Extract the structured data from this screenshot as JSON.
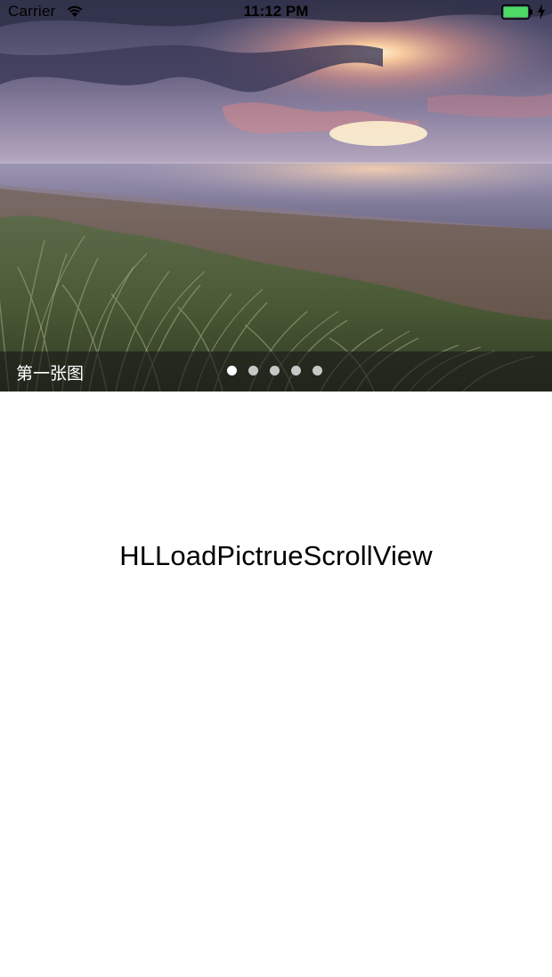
{
  "status_bar": {
    "carrier": "Carrier",
    "time": "11:12 PM",
    "battery_color": "#4cd964",
    "icons": [
      "wifi-icon",
      "battery-icon",
      "charging-bolt-icon"
    ]
  },
  "banner": {
    "caption": "第一张图",
    "page_count": 5,
    "current_page": 1,
    "active_dot_color": "#ffffff",
    "inactive_dot_color": "#c8c8c8"
  },
  "main": {
    "label": "HLLoadPictrueScrollView"
  }
}
